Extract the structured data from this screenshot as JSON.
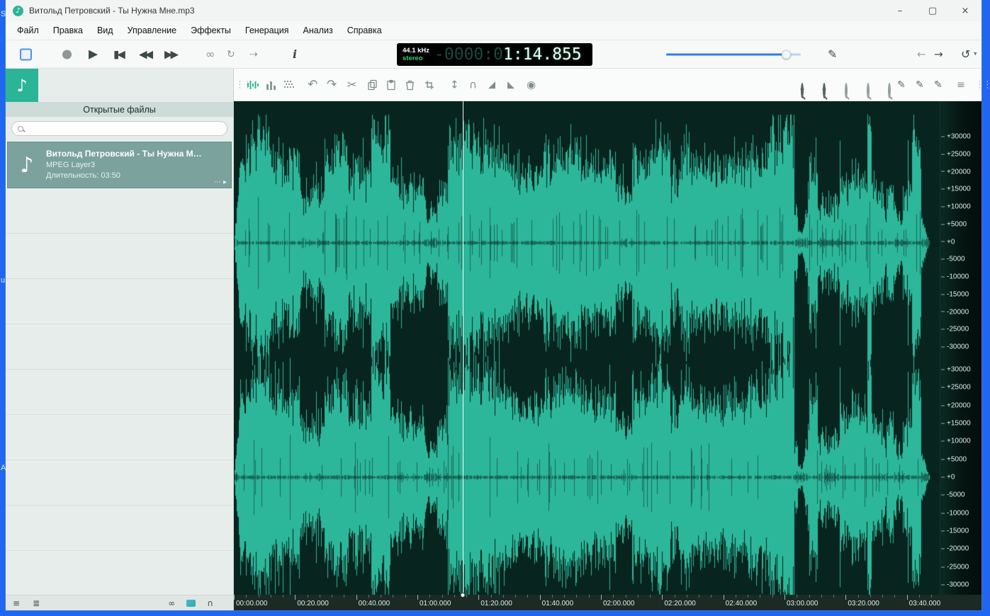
{
  "background": {
    "fragments": [
      "S",
      "u",
      "A"
    ]
  },
  "window": {
    "title": "Витольд Петровский - Ты Нужна Мне.mp3",
    "controls": {
      "minimize": "–",
      "maximize": "▢",
      "close": "×"
    }
  },
  "menu": {
    "items": [
      "Файл",
      "Правка",
      "Вид",
      "Управление",
      "Эффекты",
      "Генерация",
      "Анализ",
      "Справка"
    ]
  },
  "icons": {
    "app": "♪",
    "play": "▶",
    "skip_start": "▮◀",
    "rewind": "◀◀",
    "fast_forward": "▶▶",
    "loop": "∞",
    "repeat": "↻",
    "play_from_cursor": "⇢",
    "info": "i",
    "annotate": "✎",
    "nav_back": "←",
    "nav_forward": "→",
    "history": "↺",
    "history_caret": "▾",
    "drag_handle": "⋮⋮",
    "undo": "↶",
    "redo": "↷",
    "cut": "✂",
    "amplitude": "↕",
    "loop_section": "∩",
    "fade_in": "◢",
    "fade_out": "◣",
    "normalize": "◉",
    "pen": "✎",
    "list_view": "≡",
    "zoom_in_sign": "+",
    "zoom_out_sign": "−",
    "note": "♪",
    "card_more": "⋯",
    "card_play": "▸",
    "view_compact": "≡",
    "view_detailed": "≣",
    "link": "∞",
    "headphones": "∩"
  },
  "lcd": {
    "sample_rate": "44.1 kHz",
    "channel_mode": "stereo",
    "time_dim": "-0000:0",
    "time_bright": "1:14.855"
  },
  "sidebar": {
    "header": "Открытые файлы",
    "search_placeholder": "",
    "file": {
      "title": "Витольд Петровский - Ты Нужна М…",
      "format": "MPEG Layer3",
      "duration": "Длительность: 03:50"
    }
  },
  "waveform": {
    "colors": {
      "background": "#08241e",
      "wave": "#2cb79a",
      "wave_dark": "rgba(5,30,24,0.5)",
      "cursor": "#ffffff"
    },
    "seed": 1337,
    "envelope_max": 0.26,
    "channel_centers": [
      0.287,
      0.762
    ],
    "cursor_fraction": 0.3248,
    "view_seconds": 230.5,
    "scale_labels": [
      "+30000",
      "+25000",
      "+20000",
      "+15000",
      "+10000",
      "+5000",
      "+0",
      "-5000",
      "-10000",
      "-15000",
      "-20000",
      "-25000",
      "-30000"
    ],
    "scale_layout": [
      {
        "top": 0.0717,
        "step": 0.03553
      },
      {
        "top": 0.5438,
        "step": 0.03634
      }
    ]
  },
  "ruler": {
    "labels": [
      "00:00.000",
      "00:20.000",
      "00:40.000",
      "01:00.000",
      "01:20.000",
      "01:40.000",
      "02:00.000",
      "02:20.000",
      "02:40.000",
      "03:00.000",
      "03:20.000",
      "03:40.000"
    ],
    "seconds": [
      0,
      20,
      40,
      60,
      80,
      100,
      120,
      140,
      160,
      180,
      200,
      220
    ]
  },
  "theme": {
    "accent_blue": "#2e7df0",
    "teal": "#2bb498",
    "lcd_green": "#2ed36d"
  }
}
